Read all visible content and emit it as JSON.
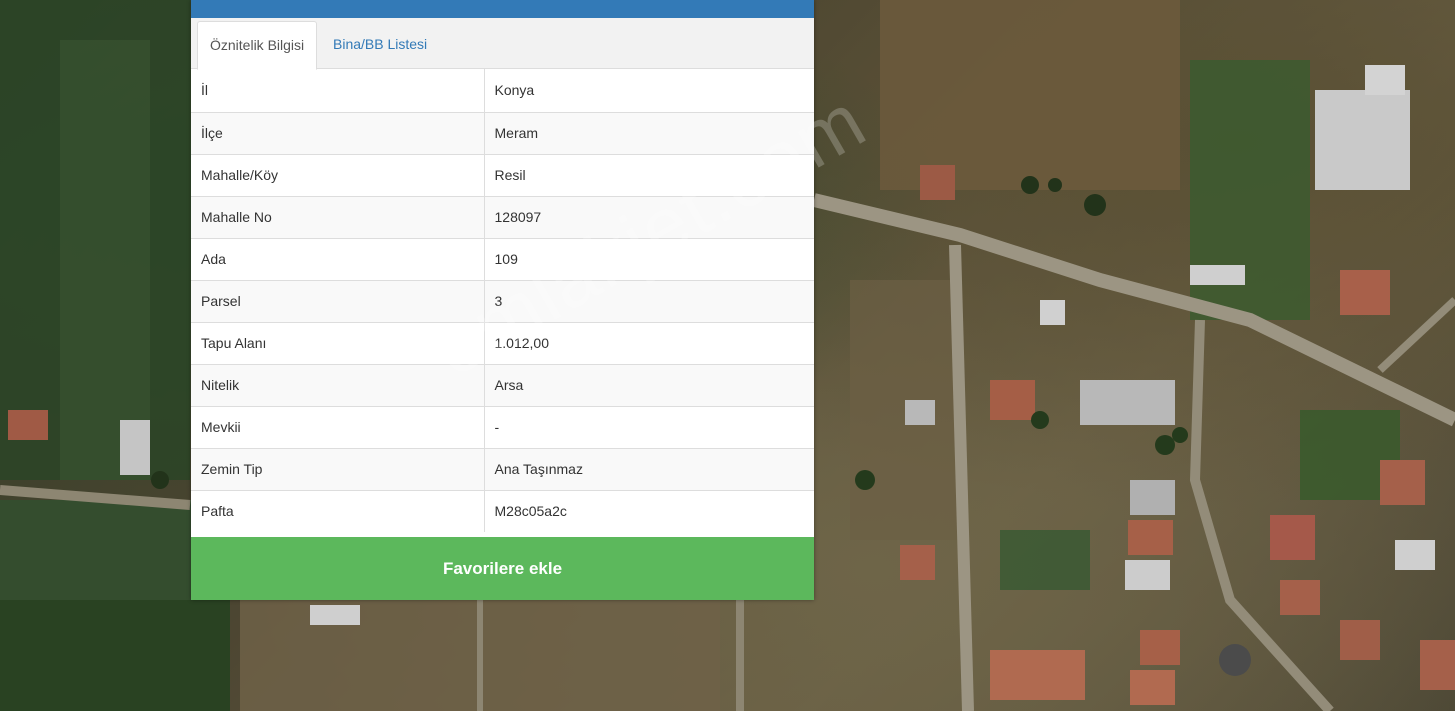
{
  "tabs": [
    {
      "label": "Öznitelik Bilgisi",
      "active": true
    },
    {
      "label": "Bina/BB Listesi",
      "active": false
    }
  ],
  "attributes": [
    {
      "key": "İl",
      "value": "Konya"
    },
    {
      "key": "İlçe",
      "value": "Meram"
    },
    {
      "key": "Mahalle/Köy",
      "value": "Resil"
    },
    {
      "key": "Mahalle No",
      "value": "128097"
    },
    {
      "key": "Ada",
      "value": "109"
    },
    {
      "key": "Parsel",
      "value": "3"
    },
    {
      "key": "Tapu Alanı",
      "value": "1.012,00"
    },
    {
      "key": "Nitelik",
      "value": "Arsa"
    },
    {
      "key": "Mevkii",
      "value": "-"
    },
    {
      "key": "Zemin Tip",
      "value": "Ana Taşınmaz"
    },
    {
      "key": "Pafta",
      "value": "M28c05a2c"
    }
  ],
  "actions": {
    "favorite_label": "Favorilere ekle"
  },
  "watermark": {
    "text": "emlakjet.com"
  },
  "colors": {
    "header": "#337ab7",
    "tab_link": "#337ab7",
    "favorite_button": "#5cb85c"
  }
}
